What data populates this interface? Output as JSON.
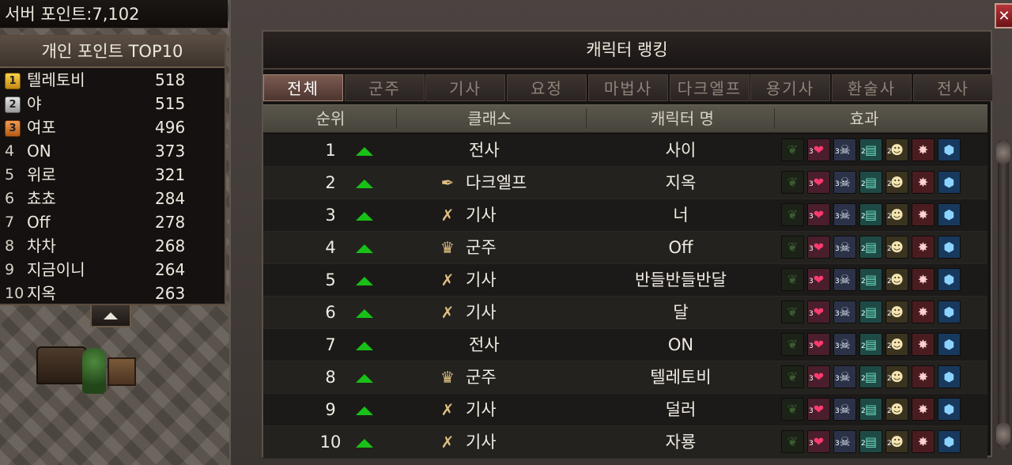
{
  "server_points": "서버 포인트:7,102",
  "top10": {
    "title": "개인 포인트 TOP10",
    "rows": [
      {
        "rank": "1",
        "name": "텔레토비",
        "score": "518"
      },
      {
        "rank": "2",
        "name": "야",
        "score": "515"
      },
      {
        "rank": "3",
        "name": "여포",
        "score": "496"
      },
      {
        "rank": "4",
        "name": "ON",
        "score": "373"
      },
      {
        "rank": "5",
        "name": "위로",
        "score": "321"
      },
      {
        "rank": "6",
        "name": "쵸쵸",
        "score": "284"
      },
      {
        "rank": "7",
        "name": "Off",
        "score": "278"
      },
      {
        "rank": "8",
        "name": "차차",
        "score": "268"
      },
      {
        "rank": "9",
        "name": "지금이니",
        "score": "264"
      },
      {
        "rank": "10",
        "name": "지옥",
        "score": "263"
      }
    ]
  },
  "panel": {
    "title": "캐릭터 랭킹",
    "close_label": "✕",
    "tabs": [
      "전체",
      "군주",
      "기사",
      "요정",
      "마법사",
      "다크엘프",
      "용기사",
      "환술사",
      "전사"
    ],
    "active_tab": 0,
    "columns": {
      "rank": "순위",
      "class": "클래스",
      "name": "캐릭터 명",
      "effects": "효과"
    },
    "rows": [
      {
        "rank": "1",
        "class": "전사",
        "class_icon": "",
        "name": "사이"
      },
      {
        "rank": "2",
        "class": "다크엘프",
        "class_icon": "dark-elf-icon",
        "name": "지옥"
      },
      {
        "rank": "3",
        "class": "기사",
        "class_icon": "knight-icon",
        "name": "너"
      },
      {
        "rank": "4",
        "class": "군주",
        "class_icon": "crown-icon",
        "name": "Off"
      },
      {
        "rank": "5",
        "class": "기사",
        "class_icon": "knight-icon",
        "name": "반들반들반달"
      },
      {
        "rank": "6",
        "class": "기사",
        "class_icon": "knight-icon",
        "name": "달"
      },
      {
        "rank": "7",
        "class": "전사",
        "class_icon": "",
        "name": "ON"
      },
      {
        "rank": "8",
        "class": "군주",
        "class_icon": "crown-icon",
        "name": "텔레토비"
      },
      {
        "rank": "9",
        "class": "기사",
        "class_icon": "knight-icon",
        "name": "덜러"
      },
      {
        "rank": "10",
        "class": "기사",
        "class_icon": "knight-icon",
        "name": "자룡"
      }
    ],
    "effect_icons": [
      "leaf-icon",
      "heart-icon",
      "skull-icon",
      "book-icon",
      "skeleton-icon",
      "poison-icon",
      "shield-icon"
    ],
    "effect_tags": [
      "",
      "3",
      "3",
      "2",
      "2",
      "",
      ""
    ]
  },
  "colors": {
    "rank_up": "#18c018",
    "active_tab": "#7b5b52"
  }
}
